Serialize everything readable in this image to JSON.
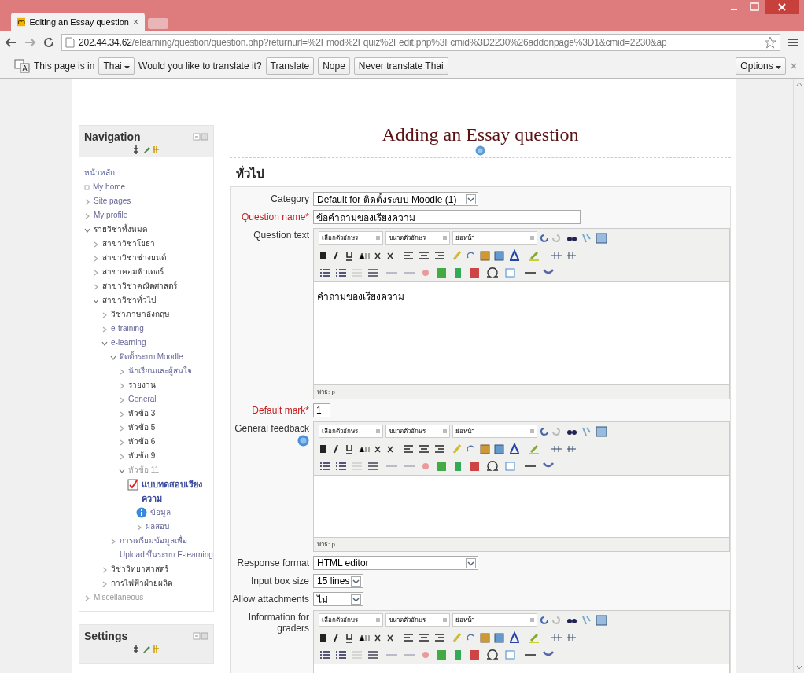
{
  "browser": {
    "tab": {
      "title": "Editing an Essay question",
      "close": "×"
    },
    "address": {
      "host": "202.44.34.62",
      "path": "/elearning/question/question.php?returnurl=%2Fmod%2Fquiz%2Fedit.php%3Fcmid%3D2230%26addonpage%3D1&cmid=2230&ap"
    },
    "translate_bar": {
      "prefix": "This page is in",
      "language": "Thai",
      "question": "Would you like to translate it?",
      "buttons": [
        "Translate",
        "Nope",
        "Never translate Thai"
      ],
      "options": "Options"
    }
  },
  "navigation": {
    "title": "Navigation",
    "home": "หน้าหลัก",
    "items": [
      {
        "label": "My home",
        "kind": "home"
      },
      {
        "label": "Site pages",
        "kind": "link",
        "expanded": false
      },
      {
        "label": "My profile",
        "kind": "link",
        "expanded": false
      },
      {
        "label": "รายวิชาทั้งหมด",
        "kind": "category",
        "expanded": true,
        "children": [
          {
            "label": "สาขาวิชาโยธา",
            "kind": "category",
            "expanded": false
          },
          {
            "label": "สาขาวิชาช่างยนต์",
            "kind": "category",
            "expanded": false
          },
          {
            "label": "สาขาคอมพิวเตอร์",
            "kind": "category",
            "expanded": false
          },
          {
            "label": "สาขาวิชาคณิตศาสตร์",
            "kind": "category",
            "expanded": false
          },
          {
            "label": "สาขาวิชาทั่วไป",
            "kind": "category",
            "expanded": true,
            "children": [
              {
                "label": "วิชาภาษาอังกฤษ",
                "kind": "category",
                "expanded": false
              },
              {
                "label": "e-training",
                "kind": "link",
                "expanded": false
              },
              {
                "label": "e-learning",
                "kind": "link",
                "expanded": true,
                "children": [
                  {
                    "label": "ติดตั้งระบบ Moodle",
                    "kind": "link",
                    "expanded": true,
                    "children": [
                      {
                        "label": "นักเรียนและผู้สนใจ",
                        "kind": "link",
                        "expanded": false
                      },
                      {
                        "label": "รายงาน",
                        "kind": "category",
                        "expanded": false
                      },
                      {
                        "label": "General",
                        "kind": "link",
                        "expanded": false
                      },
                      {
                        "label": "หัวข้อ 3",
                        "kind": "category",
                        "expanded": false
                      },
                      {
                        "label": "หัวข้อ 5",
                        "kind": "category",
                        "expanded": false
                      },
                      {
                        "label": "หัวข้อ 6",
                        "kind": "category",
                        "expanded": false
                      },
                      {
                        "label": "หัวข้อ 9",
                        "kind": "category",
                        "expanded": false
                      },
                      {
                        "label": "หัวข้อ 11",
                        "kind": "muted",
                        "expanded": true,
                        "children": [
                          {
                            "label": "แบบทดสอบเรียงความ",
                            "kind": "quiz",
                            "children": [
                              {
                                "label": "ข้อมูล",
                                "kind": "info"
                              },
                              {
                                "label": "ผลสอบ",
                                "kind": "link",
                                "expanded": false
                              }
                            ]
                          }
                        ]
                      }
                    ]
                  },
                  {
                    "label": "การเตรียมข้อมูลเพื่อ Upload ขึ้นระบบ E-learning",
                    "kind": "link",
                    "expanded": false
                  }
                ]
              },
              {
                "label": "วิชาวิทยาศาสตร์",
                "kind": "category",
                "expanded": false
              },
              {
                "label": "การไฟฟ้าฝ่ายผลิต",
                "kind": "category",
                "expanded": false
              }
            ]
          }
        ]
      },
      {
        "label": "Miscellaneous",
        "kind": "muted",
        "expanded": false
      }
    ]
  },
  "settings": {
    "title": "Settings"
  },
  "page": {
    "title": "Adding an Essay question",
    "legend": "ทั่วไป",
    "fields": [
      {
        "kind": "select",
        "label": "Category",
        "required": false,
        "help": false,
        "value": "Default for ติดตั้งระบบ Moodle (1)"
      },
      {
        "kind": "text",
        "label": "Question name*",
        "required": true,
        "help": false,
        "value": "ข้อคำถามของเรียงความ"
      },
      {
        "kind": "editor",
        "label": "Question text",
        "required": false,
        "help": false,
        "font_select": "เลือกตัวอักษร",
        "size_select": "ขนาดตัวอักษร",
        "paragraph_select": "ย่อหน้า",
        "content": "คำถามของเรียงความ",
        "path": "พาธ: p"
      },
      {
        "kind": "text",
        "label": "Default mark*",
        "required": true,
        "help": false,
        "value": "1"
      },
      {
        "kind": "editor",
        "label": "General feedback",
        "required": false,
        "help": true,
        "font_select": "เลือกตัวอักษร",
        "size_select": "ขนาดตัวอักษร",
        "paragraph_select": "ย่อหน้า",
        "path": "พาธ: p"
      },
      {
        "kind": "select",
        "label": "Response format",
        "required": false,
        "help": false,
        "value": "HTML editor"
      },
      {
        "kind": "select",
        "label": "Input box size",
        "required": false,
        "help": false,
        "value": "15 lines"
      },
      {
        "kind": "select",
        "label": "Allow attachments",
        "required": false,
        "help": false,
        "value": "ไม่"
      },
      {
        "kind": "editor",
        "label": "Information for graders",
        "required": false,
        "help": false,
        "font_select": "เลือกตัวอักษร",
        "size_select": "ขนาดตัวอักษร",
        "paragraph_select": "ย่อหน้า"
      }
    ]
  }
}
